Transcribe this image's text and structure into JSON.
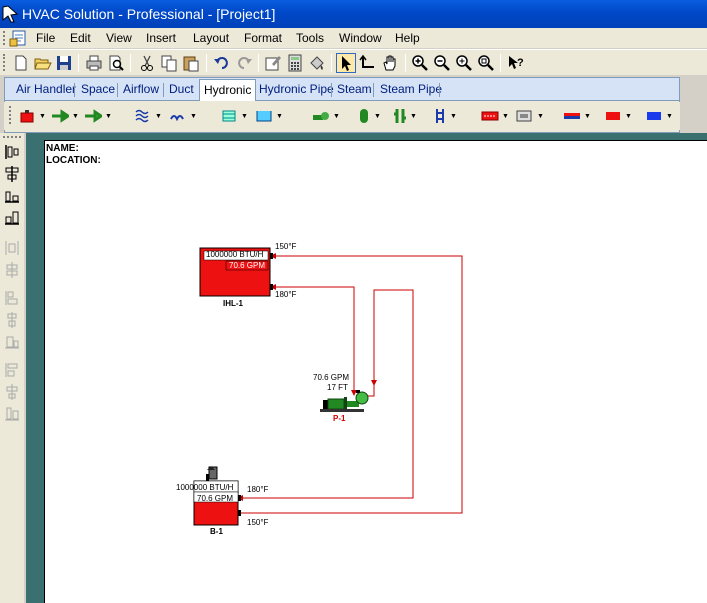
{
  "window": {
    "title": "HVAC Solution - Professional - [Project1]"
  },
  "menu": [
    {
      "label": "File"
    },
    {
      "label": "Edit"
    },
    {
      "label": "View"
    },
    {
      "label": "Insert"
    },
    {
      "label": "Layout"
    },
    {
      "label": "Format"
    },
    {
      "label": "Tools"
    },
    {
      "label": "Window"
    },
    {
      "label": "Help"
    }
  ],
  "tabs": [
    {
      "label": "Air Handler"
    },
    {
      "label": "Space"
    },
    {
      "label": "Airflow"
    },
    {
      "label": "Duct"
    },
    {
      "label": "Hydronic"
    },
    {
      "label": "Hydronic Pipe"
    },
    {
      "label": "Steam"
    },
    {
      "label": "Steam Pipe"
    }
  ],
  "selected_tab": "Hydronic",
  "drawing": {
    "name_label": "NAME:",
    "location_label": "LOCATION:",
    "heat_load": {
      "tag": "IHL-1",
      "capacity": "1000000 BTU/H",
      "flow": "70.6 GPM",
      "temp_top": "150°F",
      "temp_bottom": "180°F"
    },
    "pump": {
      "tag": "P-1",
      "flow": "70.6 GPM",
      "head": "17 FT"
    },
    "boiler": {
      "tag": "B-1",
      "capacity": "1000000 BTU/H",
      "flow": "70.6 GPM",
      "temp_top": "180°F",
      "temp_bottom": "150°F"
    }
  },
  "colors": {
    "titlebar": "#0048c8",
    "workspace": "#3a7070",
    "pipe": "#cc0000",
    "equipment_red": "#ee1111",
    "pump_green": "#228822"
  },
  "icons": {
    "toolbar": [
      "new-icon",
      "open-icon",
      "save-icon",
      "print-icon",
      "print-preview-icon",
      "cut-icon",
      "copy-icon",
      "paste-icon",
      "undo-icon",
      "redo-icon",
      "properties-icon",
      "calculator-icon",
      "paint-icon",
      "select-icon",
      "connect-icon",
      "pan-icon",
      "zoom-in-icon",
      "zoom-out-icon",
      "zoom-fit-icon",
      "zoom-window-icon",
      "help-icon"
    ]
  }
}
